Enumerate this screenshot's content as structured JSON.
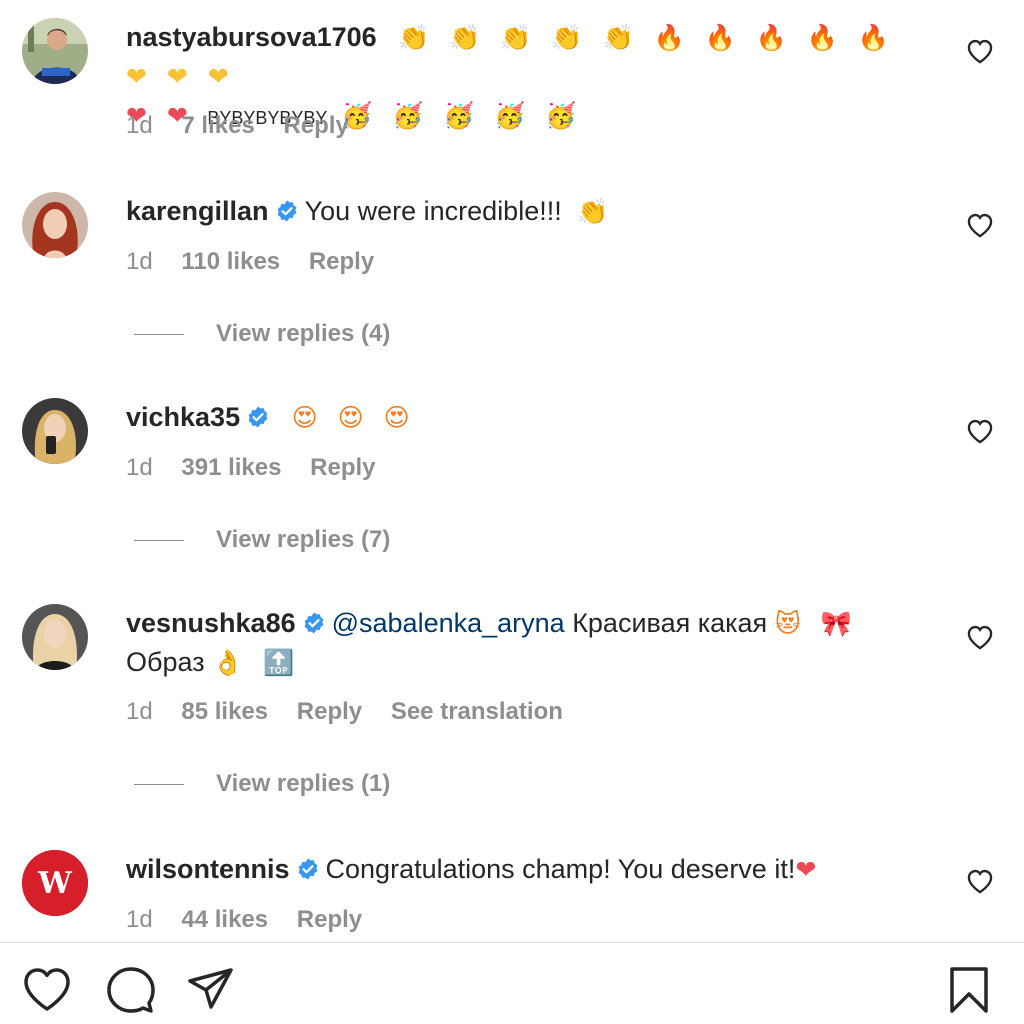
{
  "comments": [
    {
      "username": "nastyabursova1706",
      "verified": false,
      "emoji_line1": "👏 👏 👏 👏 👏 🔥 🔥 🔥 🔥 🔥 ❤ ❤ ❤",
      "emoji_line2_a": "❤ ❤",
      "caps_text": "BYBYBYBYBY",
      "emoji_line2_b": "🥳 🥳 🥳 🥳 🥳",
      "time": "1d",
      "likes": "7 likes",
      "reply": "Reply"
    },
    {
      "username": "karengillan",
      "verified": true,
      "text": "You were incredible!!!",
      "emoji": "👏",
      "time": "1d",
      "likes": "110 likes",
      "reply": "Reply",
      "view_replies": "View replies (4)"
    },
    {
      "username": "vichka35",
      "verified": true,
      "emoji": "😍 😍 😍",
      "time": "1d",
      "likes": "391 likes",
      "reply": "Reply",
      "view_replies": "View replies (7)"
    },
    {
      "username": "vesnushka86",
      "verified": true,
      "mention": "@sabalenka_aryna",
      "text": "Красивая какая",
      "emoji": "😻 🎀",
      "text2": "Образ",
      "emoji2": "👌 🔝",
      "time": "1d",
      "likes": "85 likes",
      "reply": "Reply",
      "translate": "See translation",
      "view_replies": "View replies (1)"
    },
    {
      "username": "wilsontennis",
      "verified": true,
      "text": "Congratulations champ! You deserve it!",
      "emoji": "❤",
      "time": "1d",
      "likes": "44 likes",
      "reply": "Reply",
      "avatar_letter": "W"
    }
  ],
  "colors": {
    "verified": "#3897f0",
    "wilson_red": "#d71e2b",
    "meta_gray": "#8e8e8e",
    "mention_blue": "#00376b"
  },
  "action_bar": {
    "icons": [
      "heart-icon",
      "comment-icon",
      "share-icon",
      "bookmark-icon"
    ]
  }
}
